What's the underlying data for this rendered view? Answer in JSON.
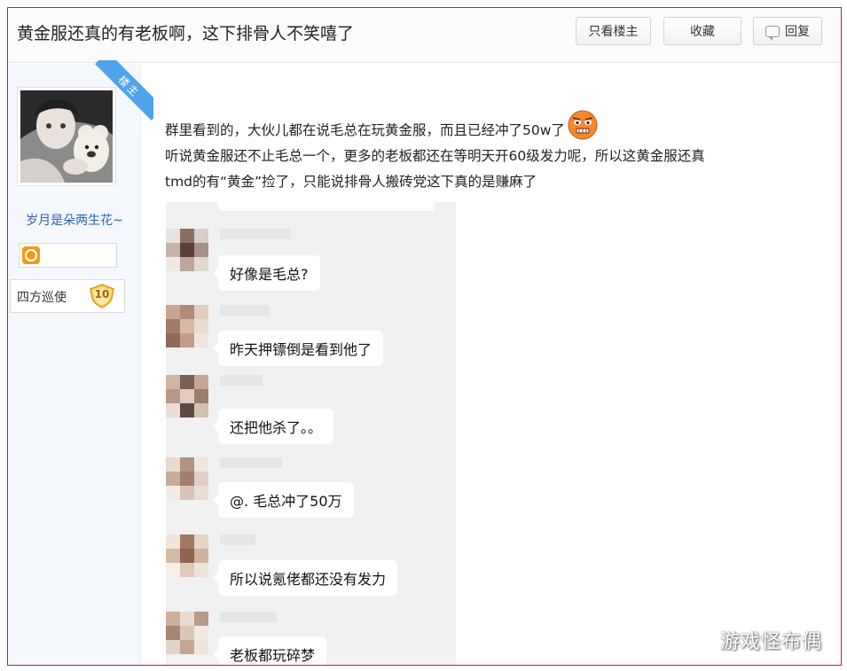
{
  "header": {
    "title": "黄金服还真的有老板啊，这下排骨人不笑嘻了",
    "only_op_label": "只看楼主",
    "favorite_label": "收藏",
    "reply_label": "回复"
  },
  "author": {
    "ribbon_label": "楼主",
    "name": "岁月是朵两生花~",
    "rank_label": "四方巡使",
    "rank_level": "10"
  },
  "post": {
    "line1": "群里看到的，大伙儿都在说毛总在玩黄金服，而且已经冲了50w了",
    "line2": "听说黄金服还不止毛总一个，更多的老板都还在等明天开60级发力呢，所以这黄金服还真",
    "line3": "tmd的有“黄金”捡了，只能说排骨人搬砖党这下真的是赚麻了"
  },
  "chat": {
    "messages": [
      {
        "text": "好像是毛总?"
      },
      {
        "text": "昨天押镖倒是看到他了"
      },
      {
        "text": "还把他杀了。。"
      },
      {
        "text": "@. 毛总冲了50万"
      },
      {
        "text": "所以说氪佬都还没有发力"
      },
      {
        "text": "老板都玩碎梦"
      }
    ]
  },
  "watermark": "游戏怪布偶",
  "colors": {
    "frame_border": "#c9202a",
    "author_name": "#2d64b3",
    "ribbon": "#4ea4e8",
    "chat_bg": "#f1f1f1"
  }
}
